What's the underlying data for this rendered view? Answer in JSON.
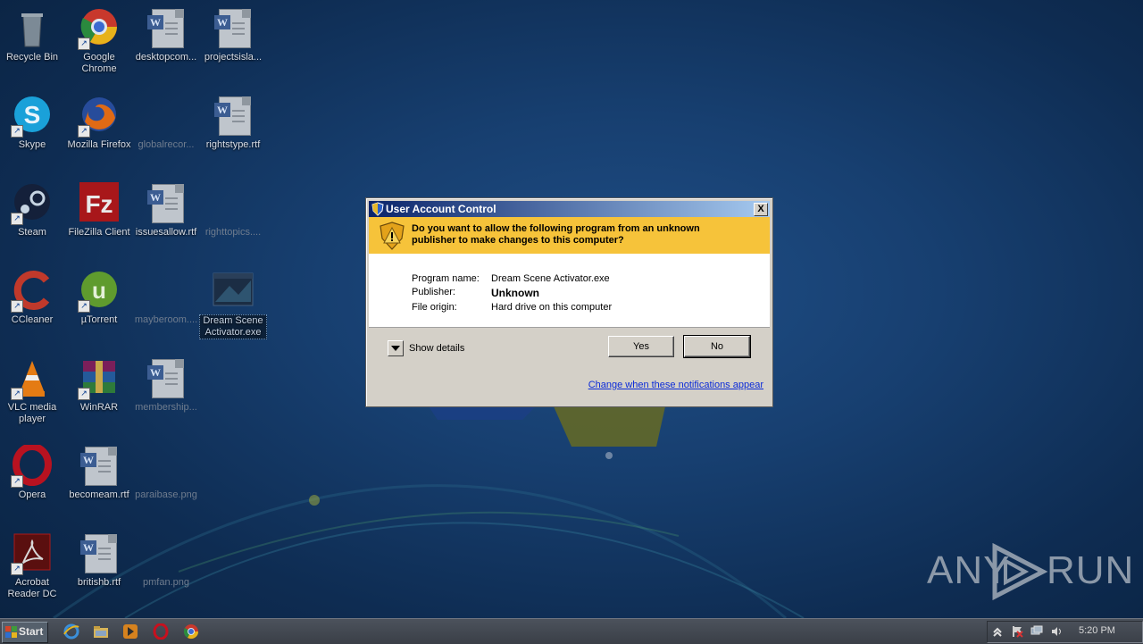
{
  "desktop": {
    "icons": [
      {
        "label": "Recycle Bin"
      },
      {
        "label": "Google Chrome"
      },
      {
        "label": "desktopcom..."
      },
      {
        "label": "projectsisla..."
      },
      {
        "label": "Skype"
      },
      {
        "label": "Mozilla Firefox"
      },
      {
        "label": "globalrecor..."
      },
      {
        "label": "rightstype.rtf"
      },
      {
        "label": "Steam"
      },
      {
        "label": "FileZilla Client"
      },
      {
        "label": "issuesallow.rtf"
      },
      {
        "label": "righttopics...."
      },
      {
        "label": "CCleaner"
      },
      {
        "label": "µTorrent"
      },
      {
        "label": "mayberoom...."
      },
      {
        "label": "Dream Scene Activator.exe"
      },
      {
        "label": "VLC media player"
      },
      {
        "label": "WinRAR"
      },
      {
        "label": "membership..."
      },
      {
        "label": "Opera"
      },
      {
        "label": "becomeam.rtf"
      },
      {
        "label": "paraibase.png"
      },
      {
        "label": "Acrobat Reader DC"
      },
      {
        "label": "britishb.rtf"
      },
      {
        "label": "pmfan.png"
      }
    ]
  },
  "uac": {
    "title": "User Account Control",
    "question": "Do you want to allow the following program from an unknown publisher to make changes to this computer?",
    "fields": [
      {
        "key": "Program name:",
        "value": "Dream Scene Activator.exe"
      },
      {
        "key": "Publisher:",
        "value": "Unknown"
      },
      {
        "key": "File origin:",
        "value": "Hard drive on this computer"
      }
    ],
    "show_details": "Show details",
    "yes": "Yes",
    "no": "No",
    "link": "Change when these notifications appear",
    "close": "X",
    "banner_color": "#f6c33a"
  },
  "watermark": {
    "left": "ANY",
    "right": "RUN"
  },
  "taskbar": {
    "start": "Start",
    "pinned": [
      "internet-explorer-icon",
      "windows-explorer-icon",
      "media-player-icon",
      "opera-icon",
      "chrome-icon"
    ],
    "clock": "5:20 PM"
  }
}
